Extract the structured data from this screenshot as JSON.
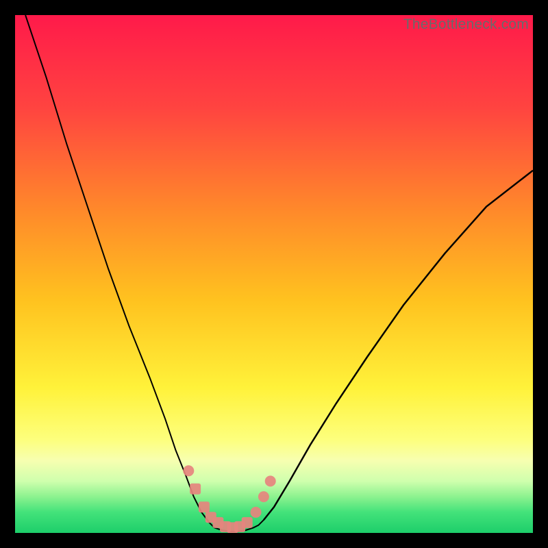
{
  "watermark": "TheBottleneck.com",
  "gradient_stops": [
    {
      "offset": 0,
      "color": "#ff1a4a"
    },
    {
      "offset": 18,
      "color": "#ff4440"
    },
    {
      "offset": 38,
      "color": "#ff8a2a"
    },
    {
      "offset": 55,
      "color": "#ffc21f"
    },
    {
      "offset": 72,
      "color": "#fff23a"
    },
    {
      "offset": 82,
      "color": "#fdff7d"
    },
    {
      "offset": 86,
      "color": "#f7ffb0"
    },
    {
      "offset": 90,
      "color": "#cfffad"
    },
    {
      "offset": 93,
      "color": "#8cf28f"
    },
    {
      "offset": 96,
      "color": "#43e27a"
    },
    {
      "offset": 100,
      "color": "#1dce6a"
    }
  ],
  "chart_data": {
    "type": "line",
    "title": "",
    "xlabel": "",
    "ylabel": "",
    "xlim": [
      0,
      100
    ],
    "ylim": [
      0,
      100
    ],
    "legend": false,
    "grid": false,
    "series": [
      {
        "name": "left-curve",
        "x": [
          2,
          6,
          10,
          14,
          18,
          22,
          26,
          29,
          31,
          33,
          34.5,
          36,
          37.5
        ],
        "values": [
          100,
          88,
          75,
          63,
          51,
          40,
          30,
          22,
          16,
          11,
          7,
          4,
          2
        ]
      },
      {
        "name": "bottom-curve",
        "x": [
          37.5,
          38.5,
          40,
          41.5,
          43,
          44.5,
          46,
          47,
          48
        ],
        "values": [
          2,
          1,
          0.5,
          0.3,
          0.3,
          0.5,
          1,
          1.5,
          2.5
        ]
      },
      {
        "name": "right-curve",
        "x": [
          48,
          50,
          53,
          57,
          62,
          68,
          75,
          83,
          91,
          100
        ],
        "values": [
          2.5,
          5,
          10,
          17,
          25,
          34,
          44,
          54,
          63,
          70
        ]
      }
    ],
    "annotations": {
      "region_meaning": "color gradient encodes bottleneck severity from high (red, top) to low (green, bottom); curve minimum near x≈42 indicates optimal balance"
    },
    "markers": [
      {
        "x": 33.5,
        "y": 12,
        "shape": "circle"
      },
      {
        "x": 34.8,
        "y": 8.5,
        "shape": "square"
      },
      {
        "x": 36.5,
        "y": 5,
        "shape": "square"
      },
      {
        "x": 37.8,
        "y": 3,
        "shape": "square"
      },
      {
        "x": 39.2,
        "y": 2,
        "shape": "square"
      },
      {
        "x": 40.6,
        "y": 1.2,
        "shape": "square"
      },
      {
        "x": 42.0,
        "y": 1.0,
        "shape": "square"
      },
      {
        "x": 43.4,
        "y": 1.2,
        "shape": "square"
      },
      {
        "x": 44.8,
        "y": 2,
        "shape": "square"
      },
      {
        "x": 46.5,
        "y": 4,
        "shape": "circle"
      },
      {
        "x": 48.0,
        "y": 7,
        "shape": "circle"
      },
      {
        "x": 49.3,
        "y": 10,
        "shape": "circle"
      }
    ]
  }
}
